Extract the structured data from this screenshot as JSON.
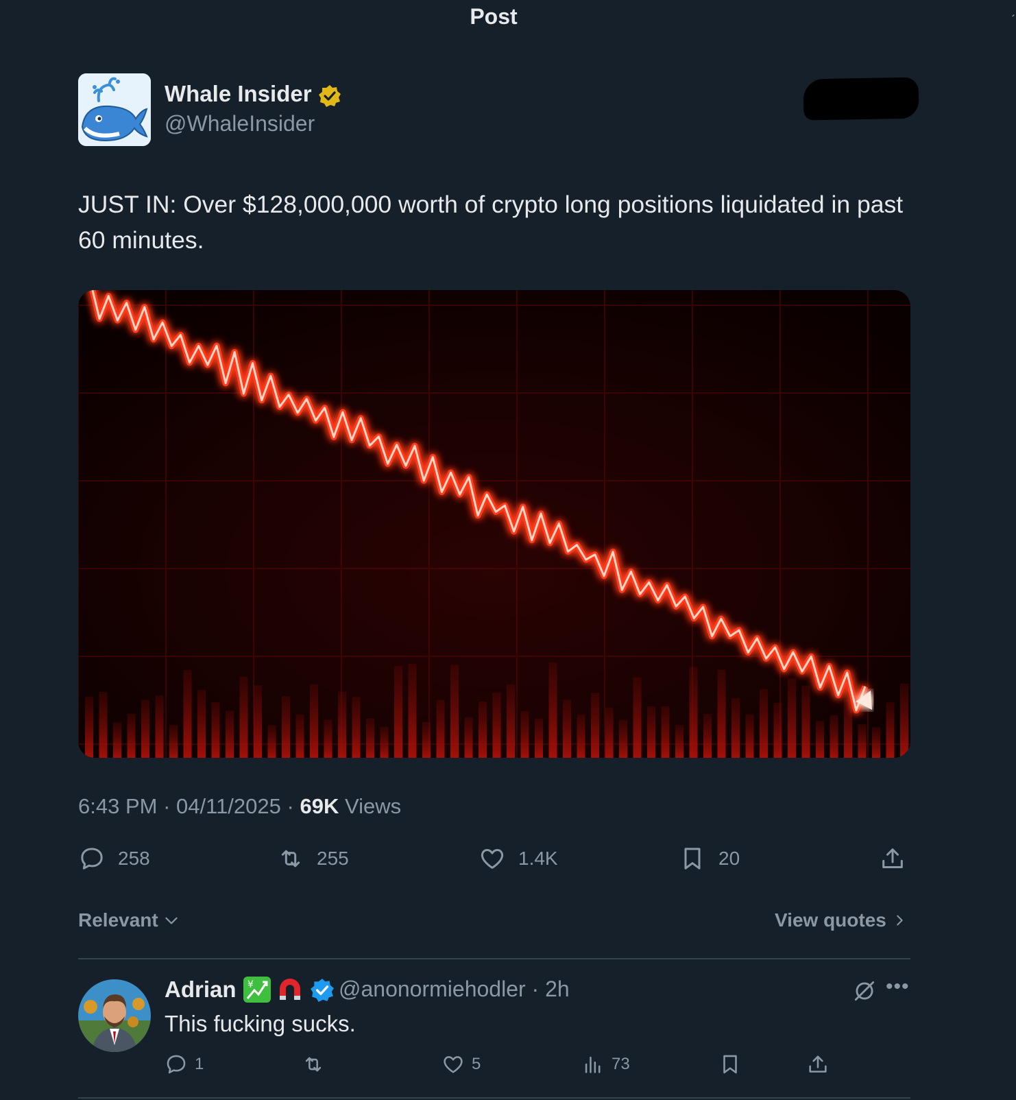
{
  "header": {
    "title": "Post"
  },
  "author": {
    "display_name": "Whale Insider",
    "handle": "@WhaleInsider",
    "verified_badge_color": "#e2b719",
    "avatar_icon": "whale-icon"
  },
  "tweet": {
    "text": "JUST IN: Over $128,000,000 worth of crypto long positions liquidated in past 60 minutes.",
    "media_icon": "falling-chart-image",
    "time": "6:43 PM",
    "date": "04/11/2025",
    "views_count": "69K",
    "views_label": "Views",
    "separator": "·"
  },
  "actions": {
    "replies": "258",
    "reposts": "255",
    "likes": "1.4K",
    "bookmarks": "20"
  },
  "sort": {
    "relevant_label": "Relevant",
    "view_quotes_label": "View quotes"
  },
  "reply": {
    "name": "Adrian",
    "handle_time": "@anonormiehodler · 2h",
    "text": "This fucking sucks.",
    "verified_badge_color": "#1d9bf0",
    "replies": "1",
    "likes": "5",
    "views": "73"
  },
  "colors": {
    "background": "#15202b",
    "text_primary": "#e7e9ea",
    "text_secondary": "#8b98a5",
    "chart_line": "#ff3b1f"
  }
}
